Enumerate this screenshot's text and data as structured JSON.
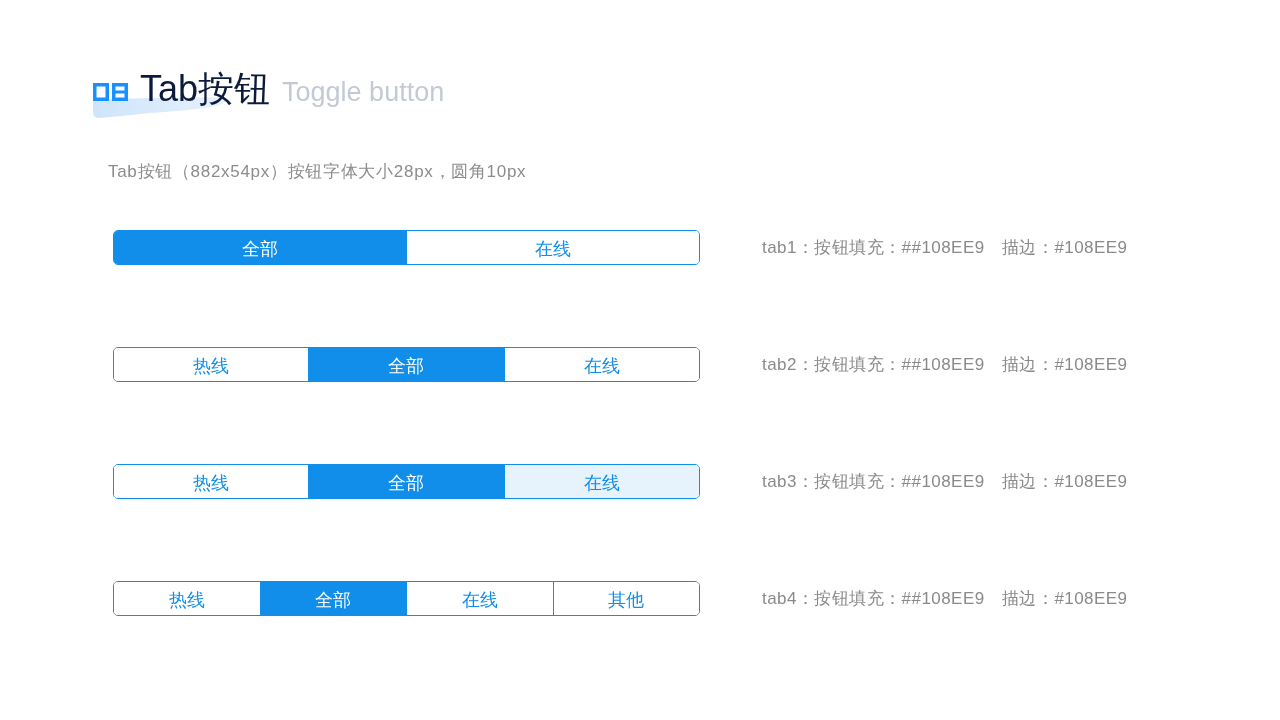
{
  "header": {
    "title": "Tab按钮",
    "subtitle": "Toggle button"
  },
  "description": "Tab按钮（882x54px）按钮字体大小28px，圆角10px",
  "examples": [
    {
      "tabs": [
        {
          "label": "全部",
          "selected": true,
          "hovered": false
        },
        {
          "label": "在线",
          "selected": false,
          "hovered": false
        }
      ],
      "note": "tab1：按钮填充：##108EE9　描边：#108EE9"
    },
    {
      "tabs": [
        {
          "label": "热线",
          "selected": false,
          "hovered": false
        },
        {
          "label": "全部",
          "selected": true,
          "hovered": false
        },
        {
          "label": "在线",
          "selected": false,
          "hovered": false
        }
      ],
      "note": "tab2：按钮填充：##108EE9　描边：#108EE9"
    },
    {
      "tabs": [
        {
          "label": "热线",
          "selected": false,
          "hovered": false
        },
        {
          "label": "全部",
          "selected": true,
          "hovered": false
        },
        {
          "label": "在线",
          "selected": false,
          "hovered": true
        }
      ],
      "note": "tab3：按钮填充：##108EE9　描边：#108EE9"
    },
    {
      "tabs": [
        {
          "label": "热线",
          "selected": false,
          "hovered": false
        },
        {
          "label": "全部",
          "selected": true,
          "hovered": false
        },
        {
          "label": "在线",
          "selected": false,
          "hovered": false
        },
        {
          "label": "其他",
          "selected": false,
          "hovered": false
        }
      ],
      "note": "tab4：按钮填充：##108EE9　描边：#108EE9"
    }
  ]
}
